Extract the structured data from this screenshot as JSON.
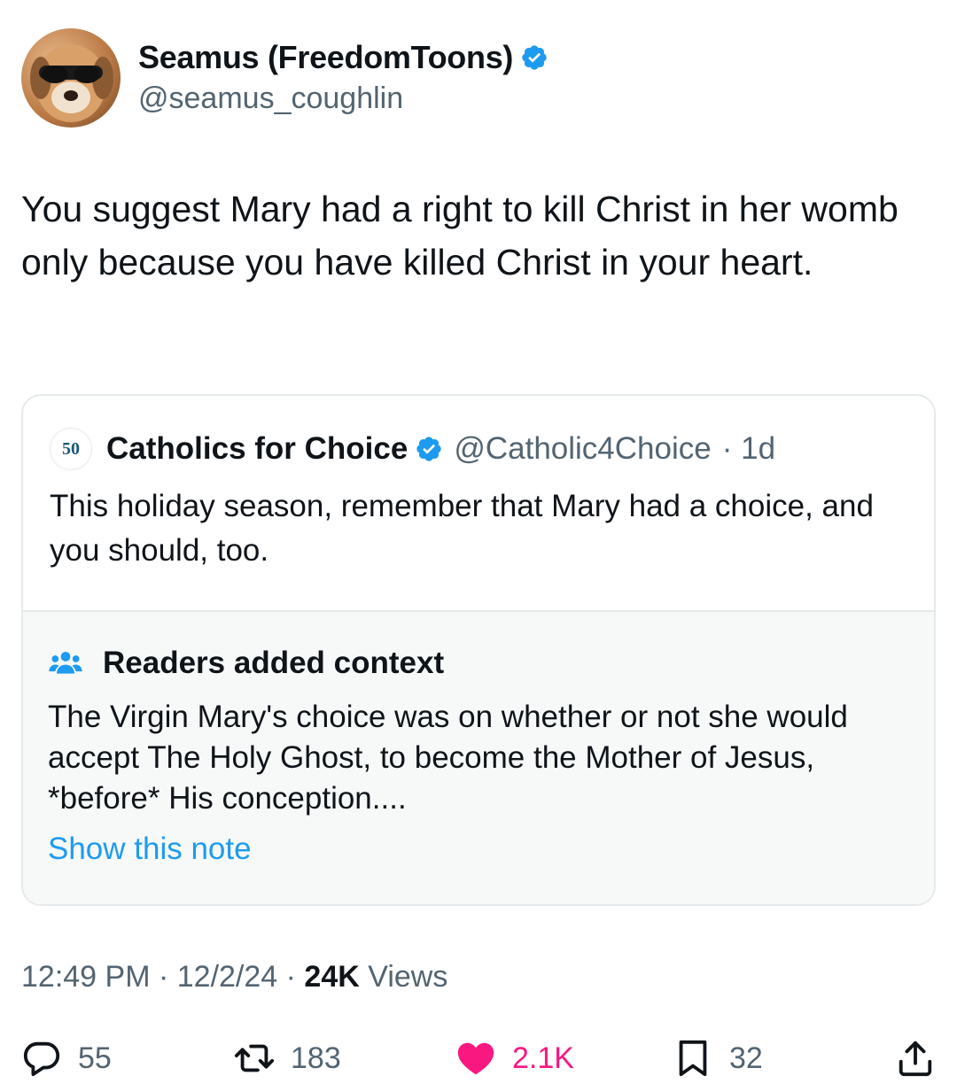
{
  "author": {
    "display_name": "Seamus (FreedomToons)",
    "handle": "@seamus_coughlin",
    "avatar_icon": "dog-with-sunglasses-avatar",
    "verified": true
  },
  "tweet": {
    "text": "You suggest Mary had a right to kill Christ in her womb only because you have killed Christ in your heart."
  },
  "quoted": {
    "logo_text": "50",
    "display_name": "Catholics for Choice",
    "handle": "@Catholic4Choice",
    "age": "· 1d",
    "text": "This holiday season, remember that Mary had a choice, and you should, too."
  },
  "community_note": {
    "title": "Readers added context",
    "text": "The Virgin Mary's choice was on whether or not she would accept The Holy Ghost, to become the Mother of Jesus, *before* His conception....",
    "link": "Show this note"
  },
  "meta": {
    "time": "12:49 PM",
    "date": "12/2/24",
    "views_count": "24K",
    "views_label": "Views",
    "separator": " · "
  },
  "actions": {
    "replies": "55",
    "reposts": "183",
    "likes": "2.1K",
    "bookmarks": "32"
  },
  "colors": {
    "accent": "#1d9bf0",
    "like": "#f91880",
    "secondary_text": "#536471"
  }
}
